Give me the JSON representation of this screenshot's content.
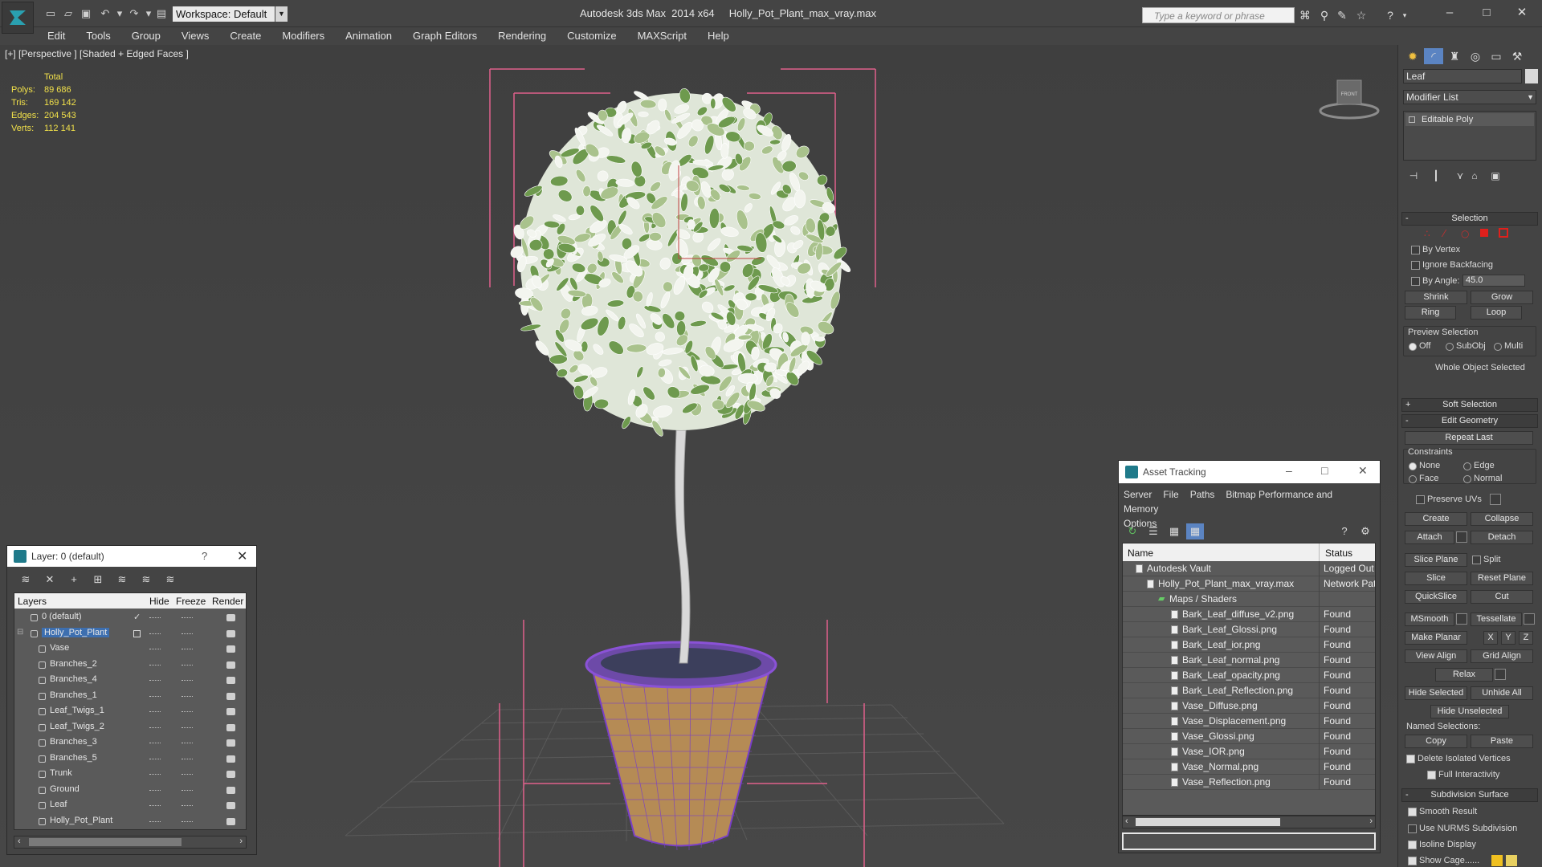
{
  "app": {
    "title": "Autodesk 3ds Max  2014 x64     Holly_Pot_Plant_max_vray.max",
    "workspace": "Workspace: Default",
    "search_placeholder": "Type a keyword or phrase"
  },
  "menu": [
    "Edit",
    "Tools",
    "Group",
    "Views",
    "Create",
    "Modifiers",
    "Animation",
    "Graph Editors",
    "Rendering",
    "Customize",
    "MAXScript",
    "Help"
  ],
  "viewport": {
    "label": "[+] [Perspective ] [Shaded + Edged Faces ]",
    "stats_header": "Total",
    "stats": [
      {
        "k": "Polys:",
        "v": "89 686"
      },
      {
        "k": "Tris:",
        "v": "169 142"
      },
      {
        "k": "Edges:",
        "v": "204 543"
      },
      {
        "k": "Verts:",
        "v": "112 141"
      }
    ],
    "viewcube_label": "FRONT"
  },
  "command_panel": {
    "object_name": "Leaf",
    "modifier_list": "Modifier List",
    "stack_item": "Editable Poly",
    "selection": {
      "title": "Selection",
      "by_vertex": "By Vertex",
      "ignore_backfacing": "Ignore Backfacing",
      "by_angle": "By Angle:",
      "angle_value": "45.0",
      "shrink": "Shrink",
      "grow": "Grow",
      "ring": "Ring",
      "loop": "Loop",
      "preview_selection": "Preview Selection",
      "off": "Off",
      "subobj": "SubObj",
      "multi": "Multi",
      "status": "Whole Object Selected"
    },
    "soft_selection": "Soft Selection",
    "edit_geometry": {
      "title": "Edit Geometry",
      "repeat_last": "Repeat Last",
      "constraints": "Constraints",
      "none": "None",
      "edge": "Edge",
      "face": "Face",
      "normal": "Normal",
      "preserve_uvs": "Preserve UVs",
      "create": "Create",
      "collapse": "Collapse",
      "attach": "Attach",
      "detach": "Detach",
      "slice_plane": "Slice Plane",
      "split": "Split",
      "slice": "Slice",
      "reset_plane": "Reset Plane",
      "quickslice": "QuickSlice",
      "cut": "Cut",
      "msmooth": "MSmooth",
      "tessellate": "Tessellate",
      "make_planar": "Make Planar",
      "x": "X",
      "y": "Y",
      "z": "Z",
      "view_align": "View Align",
      "grid_align": "Grid Align",
      "relax": "Relax",
      "hide_selected": "Hide Selected",
      "unhide_all": "Unhide All",
      "hide_unselected": "Hide Unselected",
      "named_selections": "Named Selections:",
      "copy": "Copy",
      "paste": "Paste",
      "delete_isolated": "Delete Isolated Vertices",
      "full_interactivity": "Full Interactivity"
    },
    "subdivision": {
      "title": "Subdivision Surface",
      "smooth_result": "Smooth Result",
      "use_nurms": "Use NURMS Subdivision",
      "isoline": "Isoline Display",
      "show_cage": "Show Cage......"
    }
  },
  "layer_dialog": {
    "title": "Layer: 0 (default)",
    "help": "?",
    "columns": [
      "Layers",
      "Hide",
      "Freeze",
      "Render"
    ],
    "rows": [
      {
        "name": "0 (default)",
        "level": 0,
        "check": "✓",
        "selected": false
      },
      {
        "name": "Holly_Pot_Plant",
        "level": 0,
        "check": "",
        "selected": true
      },
      {
        "name": "Vase",
        "level": 1,
        "check": "",
        "selected": false
      },
      {
        "name": "Branches_2",
        "level": 1,
        "check": "",
        "selected": false
      },
      {
        "name": "Branches_4",
        "level": 1,
        "check": "",
        "selected": false
      },
      {
        "name": "Branches_1",
        "level": 1,
        "check": "",
        "selected": false
      },
      {
        "name": "Leaf_Twigs_1",
        "level": 1,
        "check": "",
        "selected": false
      },
      {
        "name": "Leaf_Twigs_2",
        "level": 1,
        "check": "",
        "selected": false
      },
      {
        "name": "Branches_3",
        "level": 1,
        "check": "",
        "selected": false
      },
      {
        "name": "Branches_5",
        "level": 1,
        "check": "",
        "selected": false
      },
      {
        "name": "Trunk",
        "level": 1,
        "check": "",
        "selected": false
      },
      {
        "name": "Ground",
        "level": 1,
        "check": "",
        "selected": false
      },
      {
        "name": "Leaf",
        "level": 1,
        "check": "",
        "selected": false
      },
      {
        "name": "Holly_Pot_Plant",
        "level": 1,
        "check": "",
        "selected": false
      }
    ]
  },
  "asset_dialog": {
    "title": "Asset Tracking",
    "menu": [
      "Server",
      "File",
      "Paths",
      "Bitmap Performance and Memory",
      "Options"
    ],
    "columns": [
      "Name",
      "Status"
    ],
    "rows": [
      {
        "name": "Autodesk Vault",
        "status": "Logged Out",
        "level": 0
      },
      {
        "name": "Holly_Pot_Plant_max_vray.max",
        "status": "Network Pat",
        "level": 1
      },
      {
        "name": "Maps / Shaders",
        "status": "",
        "level": 2
      },
      {
        "name": "Bark_Leaf_diffuse_v2.png",
        "status": "Found",
        "level": 3
      },
      {
        "name": "Bark_Leaf_Glossi.png",
        "status": "Found",
        "level": 3
      },
      {
        "name": "Bark_Leaf_ior.png",
        "status": "Found",
        "level": 3
      },
      {
        "name": "Bark_Leaf_normal.png",
        "status": "Found",
        "level": 3
      },
      {
        "name": "Bark_Leaf_opacity.png",
        "status": "Found",
        "level": 3
      },
      {
        "name": "Bark_Leaf_Reflection.png",
        "status": "Found",
        "level": 3
      },
      {
        "name": "Vase_Diffuse.png",
        "status": "Found",
        "level": 3
      },
      {
        "name": "Vase_Displacement.png",
        "status": "Found",
        "level": 3
      },
      {
        "name": "Vase_Glossi.png",
        "status": "Found",
        "level": 3
      },
      {
        "name": "Vase_IOR.png",
        "status": "Found",
        "level": 3
      },
      {
        "name": "Vase_Normal.png",
        "status": "Found",
        "level": 3
      },
      {
        "name": "Vase_Reflection.png",
        "status": "Found",
        "level": 3
      }
    ]
  },
  "colors": {
    "selection_red": "#e0201c",
    "layer_selected": "#3d6fb0",
    "stats_yellow": "#f2e14a",
    "bbox_pink": "#e0608c",
    "pot_purple": "#7a3fc7"
  }
}
